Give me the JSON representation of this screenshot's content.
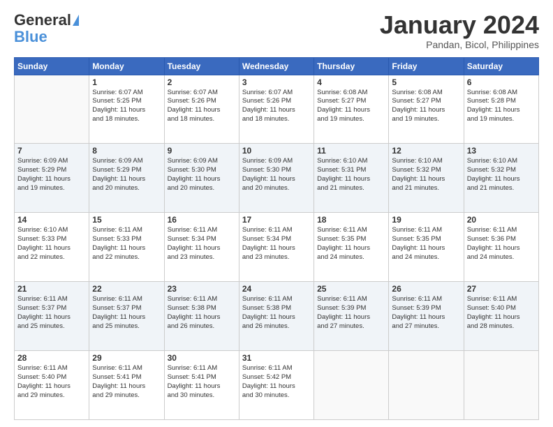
{
  "header": {
    "logo_general": "General",
    "logo_blue": "Blue",
    "month_title": "January 2024",
    "subtitle": "Pandan, Bicol, Philippines"
  },
  "days_of_week": [
    "Sunday",
    "Monday",
    "Tuesday",
    "Wednesday",
    "Thursday",
    "Friday",
    "Saturday"
  ],
  "weeks": [
    [
      {
        "day": "",
        "info": ""
      },
      {
        "day": "1",
        "info": "Sunrise: 6:07 AM\nSunset: 5:25 PM\nDaylight: 11 hours\nand 18 minutes."
      },
      {
        "day": "2",
        "info": "Sunrise: 6:07 AM\nSunset: 5:26 PM\nDaylight: 11 hours\nand 18 minutes."
      },
      {
        "day": "3",
        "info": "Sunrise: 6:07 AM\nSunset: 5:26 PM\nDaylight: 11 hours\nand 18 minutes."
      },
      {
        "day": "4",
        "info": "Sunrise: 6:08 AM\nSunset: 5:27 PM\nDaylight: 11 hours\nand 19 minutes."
      },
      {
        "day": "5",
        "info": "Sunrise: 6:08 AM\nSunset: 5:27 PM\nDaylight: 11 hours\nand 19 minutes."
      },
      {
        "day": "6",
        "info": "Sunrise: 6:08 AM\nSunset: 5:28 PM\nDaylight: 11 hours\nand 19 minutes."
      }
    ],
    [
      {
        "day": "7",
        "info": "Sunrise: 6:09 AM\nSunset: 5:29 PM\nDaylight: 11 hours\nand 19 minutes."
      },
      {
        "day": "8",
        "info": "Sunrise: 6:09 AM\nSunset: 5:29 PM\nDaylight: 11 hours\nand 20 minutes."
      },
      {
        "day": "9",
        "info": "Sunrise: 6:09 AM\nSunset: 5:30 PM\nDaylight: 11 hours\nand 20 minutes."
      },
      {
        "day": "10",
        "info": "Sunrise: 6:09 AM\nSunset: 5:30 PM\nDaylight: 11 hours\nand 20 minutes."
      },
      {
        "day": "11",
        "info": "Sunrise: 6:10 AM\nSunset: 5:31 PM\nDaylight: 11 hours\nand 21 minutes."
      },
      {
        "day": "12",
        "info": "Sunrise: 6:10 AM\nSunset: 5:32 PM\nDaylight: 11 hours\nand 21 minutes."
      },
      {
        "day": "13",
        "info": "Sunrise: 6:10 AM\nSunset: 5:32 PM\nDaylight: 11 hours\nand 21 minutes."
      }
    ],
    [
      {
        "day": "14",
        "info": "Sunrise: 6:10 AM\nSunset: 5:33 PM\nDaylight: 11 hours\nand 22 minutes."
      },
      {
        "day": "15",
        "info": "Sunrise: 6:11 AM\nSunset: 5:33 PM\nDaylight: 11 hours\nand 22 minutes."
      },
      {
        "day": "16",
        "info": "Sunrise: 6:11 AM\nSunset: 5:34 PM\nDaylight: 11 hours\nand 23 minutes."
      },
      {
        "day": "17",
        "info": "Sunrise: 6:11 AM\nSunset: 5:34 PM\nDaylight: 11 hours\nand 23 minutes."
      },
      {
        "day": "18",
        "info": "Sunrise: 6:11 AM\nSunset: 5:35 PM\nDaylight: 11 hours\nand 24 minutes."
      },
      {
        "day": "19",
        "info": "Sunrise: 6:11 AM\nSunset: 5:35 PM\nDaylight: 11 hours\nand 24 minutes."
      },
      {
        "day": "20",
        "info": "Sunrise: 6:11 AM\nSunset: 5:36 PM\nDaylight: 11 hours\nand 24 minutes."
      }
    ],
    [
      {
        "day": "21",
        "info": "Sunrise: 6:11 AM\nSunset: 5:37 PM\nDaylight: 11 hours\nand 25 minutes."
      },
      {
        "day": "22",
        "info": "Sunrise: 6:11 AM\nSunset: 5:37 PM\nDaylight: 11 hours\nand 25 minutes."
      },
      {
        "day": "23",
        "info": "Sunrise: 6:11 AM\nSunset: 5:38 PM\nDaylight: 11 hours\nand 26 minutes."
      },
      {
        "day": "24",
        "info": "Sunrise: 6:11 AM\nSunset: 5:38 PM\nDaylight: 11 hours\nand 26 minutes."
      },
      {
        "day": "25",
        "info": "Sunrise: 6:11 AM\nSunset: 5:39 PM\nDaylight: 11 hours\nand 27 minutes."
      },
      {
        "day": "26",
        "info": "Sunrise: 6:11 AM\nSunset: 5:39 PM\nDaylight: 11 hours\nand 27 minutes."
      },
      {
        "day": "27",
        "info": "Sunrise: 6:11 AM\nSunset: 5:40 PM\nDaylight: 11 hours\nand 28 minutes."
      }
    ],
    [
      {
        "day": "28",
        "info": "Sunrise: 6:11 AM\nSunset: 5:40 PM\nDaylight: 11 hours\nand 29 minutes."
      },
      {
        "day": "29",
        "info": "Sunrise: 6:11 AM\nSunset: 5:41 PM\nDaylight: 11 hours\nand 29 minutes."
      },
      {
        "day": "30",
        "info": "Sunrise: 6:11 AM\nSunset: 5:41 PM\nDaylight: 11 hours\nand 30 minutes."
      },
      {
        "day": "31",
        "info": "Sunrise: 6:11 AM\nSunset: 5:42 PM\nDaylight: 11 hours\nand 30 minutes."
      },
      {
        "day": "",
        "info": ""
      },
      {
        "day": "",
        "info": ""
      },
      {
        "day": "",
        "info": ""
      }
    ]
  ]
}
